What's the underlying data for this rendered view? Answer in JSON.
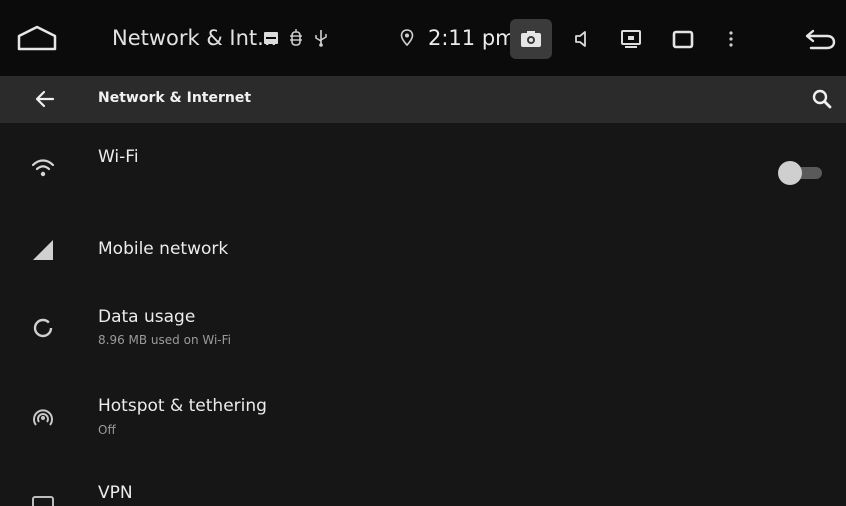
{
  "status_bar": {
    "title": "Network & Int...",
    "time": "2:11 pm",
    "icons": [
      "home-icon",
      "notification-icon",
      "usb-debug-icon",
      "usb-icon",
      "location-icon",
      "screenshot-icon",
      "volume-icon",
      "screen-cast-icon",
      "recents-icon",
      "more-icon",
      "back-icon"
    ]
  },
  "app_bar": {
    "title": "Network & Internet"
  },
  "items": [
    {
      "title": "Wi-Fi",
      "subtitle": "",
      "icon": "wifi-icon"
    },
    {
      "title": "Mobile network",
      "subtitle": "",
      "icon": "signal-icon"
    },
    {
      "title": "Data usage",
      "subtitle": "8.96 MB used on Wi-Fi",
      "icon": "data-usage-icon"
    },
    {
      "title": "Hotspot & tethering",
      "subtitle": "Off",
      "icon": "hotspot-icon"
    },
    {
      "title": "VPN",
      "subtitle": "",
      "icon": "vpn-icon"
    }
  ],
  "wifi_toggle": {
    "enabled": false
  },
  "colors": {
    "status_bar_bg": "#0b0b0b",
    "app_bar_bg": "#2b2b2b",
    "content_bg": "#161616",
    "text_primary": "#ececec",
    "text_secondary": "#9a9a9a"
  }
}
